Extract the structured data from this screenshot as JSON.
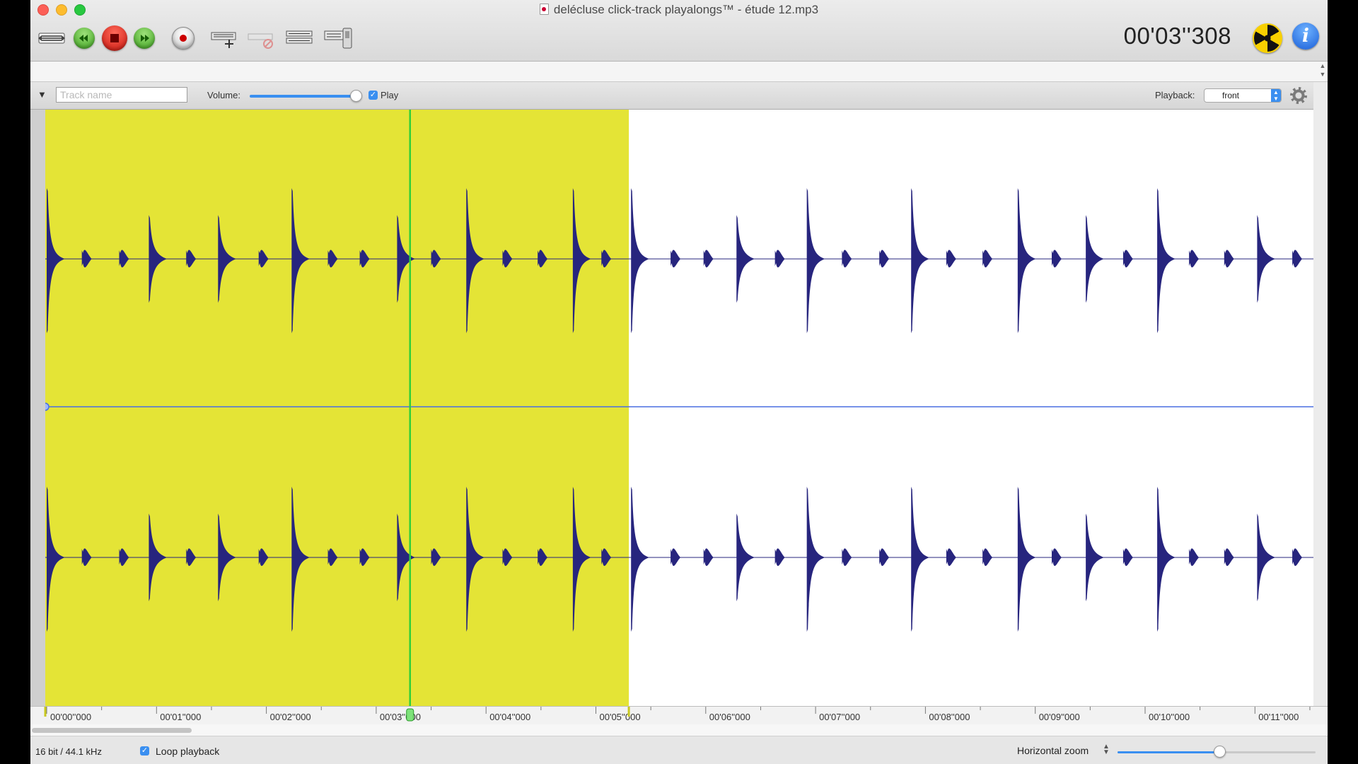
{
  "window": {
    "title": "delécluse click-track playalongs™ - étude 12.mp3",
    "doc_icon": "mp3-document-icon"
  },
  "toolbar": {
    "buttons": [
      {
        "name": "marker-list-button",
        "icon": "marker-list-icon"
      },
      {
        "name": "rewind-button",
        "icon": "rewind-icon"
      },
      {
        "name": "stop-button",
        "icon": "stop-icon"
      },
      {
        "name": "fast-forward-button",
        "icon": "fast-forward-icon"
      },
      {
        "name": "record-button",
        "icon": "record-icon"
      },
      {
        "name": "add-marker-button",
        "icon": "add-marker-icon"
      },
      {
        "name": "remove-marker-button",
        "icon": "remove-marker-icon"
      },
      {
        "name": "track-settings-button",
        "icon": "tracks-icon"
      },
      {
        "name": "export-button",
        "icon": "export-icon"
      }
    ],
    "timer": "00'03''308",
    "radiation_icon": "radiation-icon",
    "info_icon": "info-icon",
    "info_glyph": "i"
  },
  "track": {
    "name_placeholder": "Track name",
    "name_value": "",
    "volume_label": "Volume:",
    "volume_level": 1.0,
    "play_checked": true,
    "play_label": "Play",
    "playback_label": "Playback:",
    "playback_value": "front",
    "settings_icon": "gear-icon"
  },
  "waveform": {
    "duration_s": 11.55,
    "playhead_s": 3.308,
    "selection": [
      0.0,
      5.3
    ],
    "selection_color": "#e4e436",
    "wave_color": "#27257e",
    "playhead_color": "#2fcf3a",
    "center_line_color": "#4a6ee0",
    "click_times_s": [
      0.0,
      0.32,
      0.66,
      0.93,
      1.27,
      1.56,
      1.93,
      2.23,
      2.56,
      2.85,
      3.19,
      3.5,
      3.82,
      4.15,
      4.47,
      4.79,
      5.05,
      5.32,
      5.68,
      5.98,
      6.28,
      6.63,
      6.92,
      7.24,
      7.58,
      7.87,
      8.19,
      8.52,
      8.84,
      9.15,
      9.46,
      9.8,
      10.11,
      10.4,
      10.72,
      11.02,
      11.34
    ],
    "click_amplitudes": [
      1.0,
      0.15,
      0.15,
      0.6,
      0.15,
      0.5,
      0.15,
      1.0,
      0.15,
      0.15,
      0.5,
      0.15,
      1.0,
      0.15,
      0.15,
      0.9,
      0.15,
      1.0,
      0.15,
      0.15,
      0.6,
      0.15,
      0.9,
      0.15,
      0.15,
      1.0,
      0.15,
      0.15,
      0.9,
      0.15,
      0.5,
      0.15,
      1.0,
      0.15,
      0.15,
      0.5,
      0.15
    ]
  },
  "ruler": {
    "labels": [
      "00'00''000",
      "00'01''000",
      "00'02''000",
      "00'03''000",
      "00'04''000",
      "00'05''000",
      "00'06''000",
      "00'07''000",
      "00'08''000",
      "00'09''000",
      "00'10''000",
      "00'11''000"
    ]
  },
  "status": {
    "format": "16 bit / 44.1 kHz",
    "loop_checked": true,
    "loop_label": "Loop playback",
    "zoom_label": "Horizontal zoom",
    "zoom_level": 0.49
  }
}
